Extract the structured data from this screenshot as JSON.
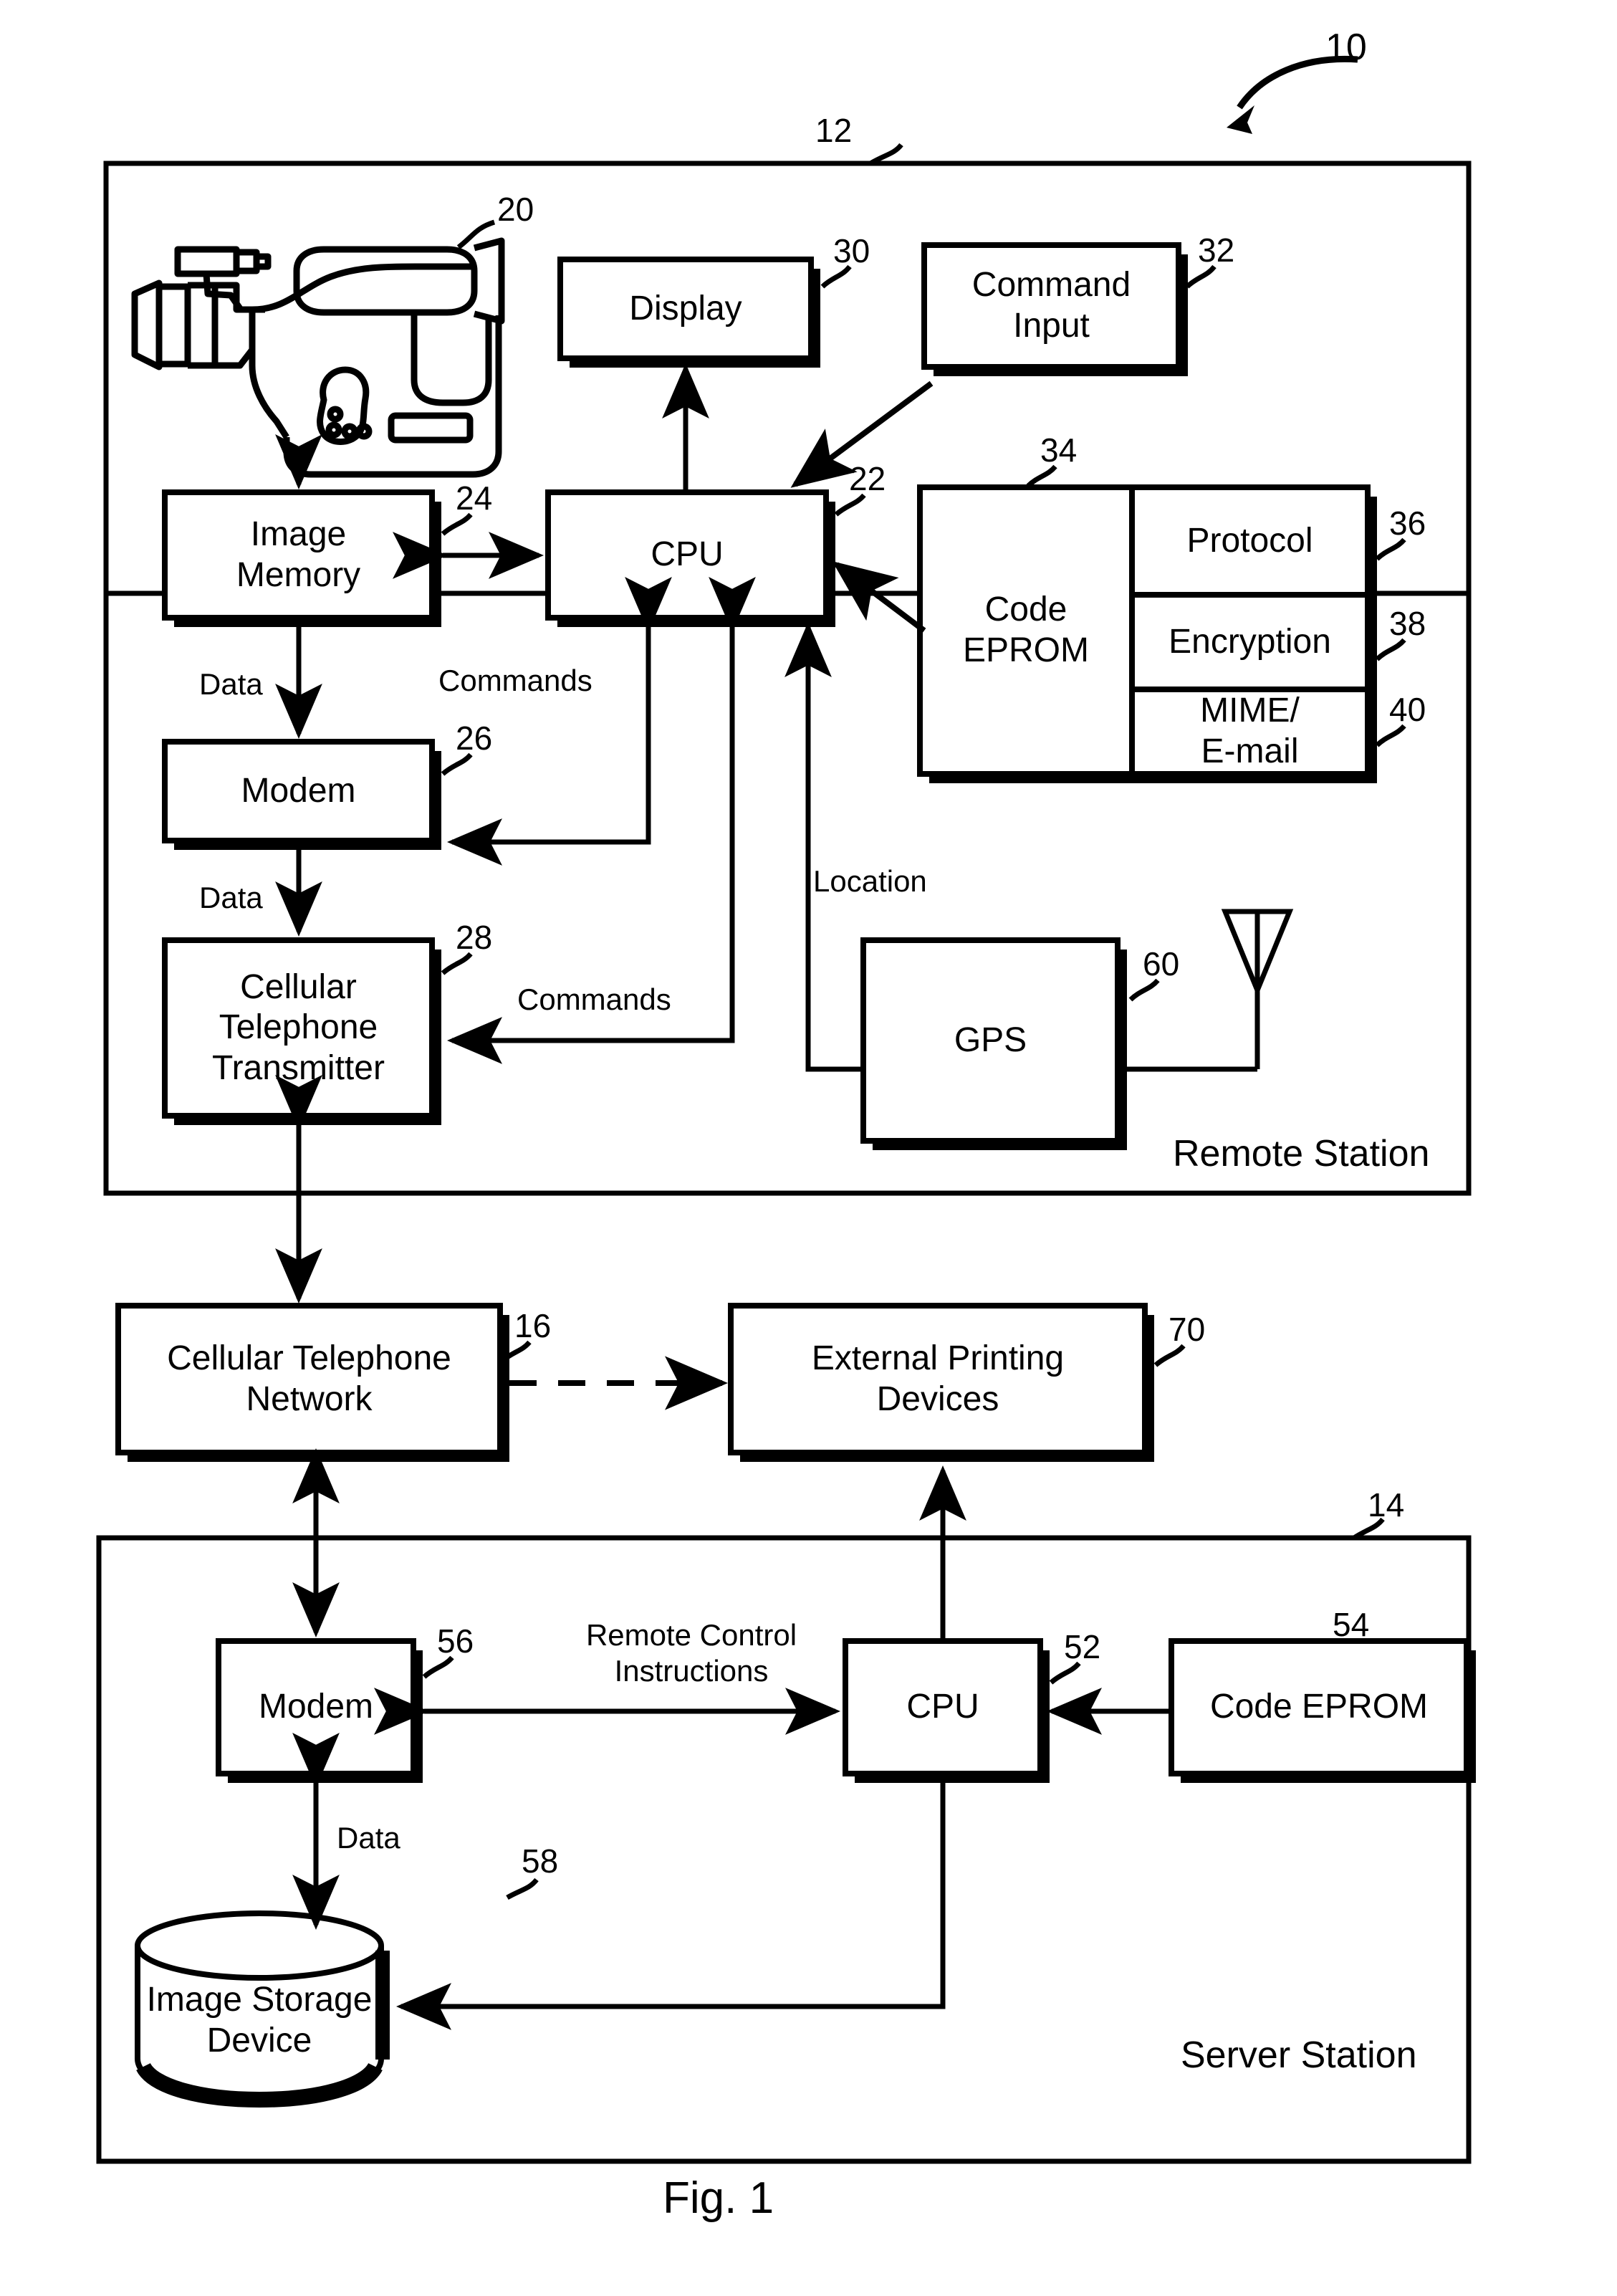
{
  "figure": {
    "caption": "Fig. 1",
    "top_ref": "10"
  },
  "stations": [
    {
      "id": "remote-station",
      "label": "Remote Station",
      "ref": "12"
    },
    {
      "id": "server-station",
      "label": "Server Station",
      "ref": "14"
    }
  ],
  "blocks": [
    {
      "id": "camcorder",
      "label": "",
      "ref": "20"
    },
    {
      "id": "display",
      "label": "Display",
      "ref": "30"
    },
    {
      "id": "command-input",
      "label": "Command\nInput",
      "ref": "32"
    },
    {
      "id": "image-memory",
      "label": "Image\nMemory",
      "ref": "24"
    },
    {
      "id": "cpu-remote",
      "label": "CPU",
      "ref": "22"
    },
    {
      "id": "code-eprom-remote",
      "label": "Code\nEPROM",
      "ref": "34"
    },
    {
      "id": "protocol",
      "label": "Protocol",
      "ref": "36"
    },
    {
      "id": "encryption",
      "label": "Encryption",
      "ref": "38"
    },
    {
      "id": "mime-email",
      "label": "MIME/\nE-mail",
      "ref": "40"
    },
    {
      "id": "modem-remote",
      "label": "Modem",
      "ref": "26"
    },
    {
      "id": "cell-transmitter",
      "label": "Cellular\nTelephone\nTransmitter",
      "ref": "28"
    },
    {
      "id": "gps",
      "label": "GPS",
      "ref": "60"
    },
    {
      "id": "cell-network",
      "label": "Cellular Telephone\nNetwork",
      "ref": "16"
    },
    {
      "id": "external-printing",
      "label": "External Printing\nDevices",
      "ref": "70"
    },
    {
      "id": "modem-server",
      "label": "Modem",
      "ref": "56"
    },
    {
      "id": "cpu-server",
      "label": "CPU",
      "ref": "52"
    },
    {
      "id": "code-eprom-server",
      "label": "Code EPROM",
      "ref": "54"
    },
    {
      "id": "image-storage",
      "label": "Image Storage\nDevice",
      "ref": "58"
    }
  ],
  "edge_labels": [
    {
      "id": "data-mem-modem",
      "text": "Data"
    },
    {
      "id": "commands-cpu-modem",
      "text": "Commands"
    },
    {
      "id": "data-modem-cell",
      "text": "Data"
    },
    {
      "id": "commands-cpu-cell",
      "text": "Commands"
    },
    {
      "id": "location-gps-cpu",
      "text": "Location"
    },
    {
      "id": "remote-control-instr",
      "text": "Remote Control\nInstructions"
    },
    {
      "id": "data-modem-storage",
      "text": "Data"
    }
  ],
  "colors": {
    "line": "#000000",
    "background": "#ffffff"
  }
}
